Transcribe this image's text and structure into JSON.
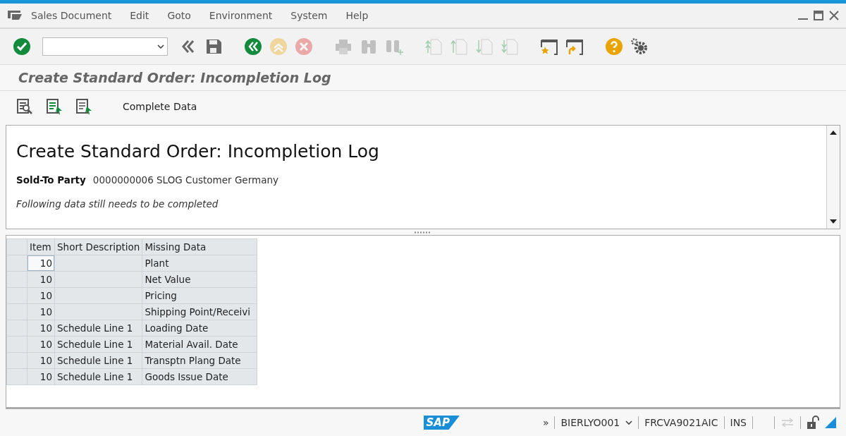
{
  "menu": [
    "Sales Document",
    "Edit",
    "Goto",
    "Environment",
    "System",
    "Help"
  ],
  "toolbar": [
    {
      "kind": "enter",
      "disabled": false
    },
    {
      "kind": "command"
    },
    {
      "kind": "collapse",
      "disabled": false
    },
    {
      "kind": "save",
      "disabled": false
    },
    {
      "kind": "sep"
    },
    {
      "kind": "back",
      "disabled": false
    },
    {
      "kind": "exit",
      "disabled": true
    },
    {
      "kind": "cancel",
      "disabled": true
    },
    {
      "kind": "sep"
    },
    {
      "kind": "print",
      "disabled": true
    },
    {
      "kind": "find",
      "disabled": true
    },
    {
      "kind": "findnext",
      "disabled": true
    },
    {
      "kind": "sep"
    },
    {
      "kind": "first",
      "disabled": true
    },
    {
      "kind": "prev",
      "disabled": true
    },
    {
      "kind": "next",
      "disabled": true
    },
    {
      "kind": "last",
      "disabled": true
    },
    {
      "kind": "sep"
    },
    {
      "kind": "session",
      "disabled": false
    },
    {
      "kind": "shortcut",
      "disabled": false
    },
    {
      "kind": "sep"
    },
    {
      "kind": "help",
      "disabled": false
    },
    {
      "kind": "settings",
      "disabled": false
    }
  ],
  "title": "Create Standard Order: Incompletion Log",
  "app_toolbar": {
    "icons": [
      {
        "kind": "details"
      },
      {
        "kind": "select-all"
      },
      {
        "kind": "deselect-all"
      }
    ],
    "button": "Complete Data"
  },
  "header": {
    "heading": "Create Standard Order: Incompletion Log",
    "label": "Sold-To Party",
    "value": "0000000006 SLOG Customer Germany",
    "note": "Following data still needs to be completed"
  },
  "table": {
    "columns": [
      "Item",
      "Short Description",
      "Missing Data"
    ],
    "rows": [
      {
        "item": "10",
        "short_description": "",
        "missing_data": "Plant",
        "selected": true
      },
      {
        "item": "10",
        "short_description": "",
        "missing_data": "Net Value",
        "selected": false
      },
      {
        "item": "10",
        "short_description": "",
        "missing_data": "Pricing",
        "selected": false
      },
      {
        "item": "10",
        "short_description": "",
        "missing_data": "Shipping Point/Receivi",
        "selected": false
      },
      {
        "item": "10",
        "short_description": "Schedule Line 1",
        "missing_data": "Loading Date",
        "selected": false
      },
      {
        "item": "10",
        "short_description": "Schedule Line 1",
        "missing_data": "Material Avail. Date",
        "selected": false
      },
      {
        "item": "10",
        "short_description": "Schedule Line 1",
        "missing_data": "Transptn Plang Date",
        "selected": false
      },
      {
        "item": "10",
        "short_description": "Schedule Line 1",
        "missing_data": "Goods Issue Date",
        "selected": false
      }
    ]
  },
  "status_bar": {
    "logo": "SAP",
    "expand": "»",
    "user": "BIERLYO001",
    "server": "FRCVA9021AIC",
    "mode": "INS"
  }
}
